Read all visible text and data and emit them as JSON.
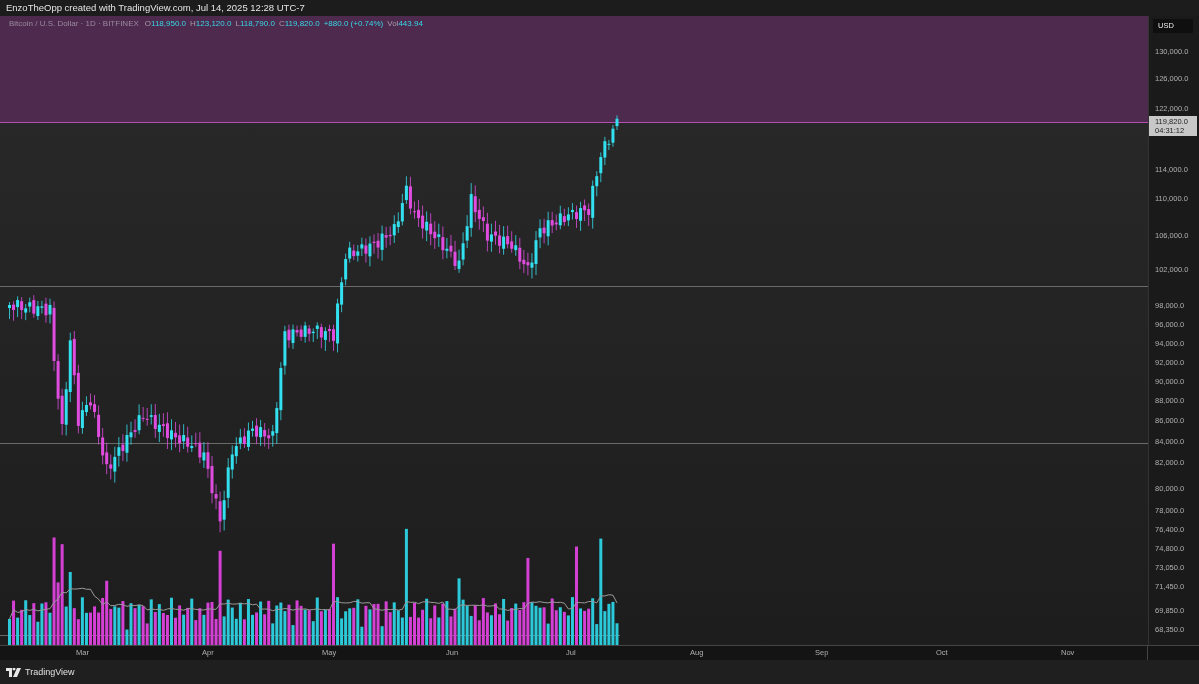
{
  "header": {
    "title": "EnzoTheOpp created with TradingView.com, Jul 14, 2025 12:28 UTC-7"
  },
  "legend": {
    "symbol": "Bitcoin / U.S. Dollar · 1D · BITFINEX",
    "ohlc": [
      {
        "label": "O",
        "value": "118,950.0"
      },
      {
        "label": "H",
        "value": "123,120.0"
      },
      {
        "label": "L",
        "value": "118,790.0"
      },
      {
        "label": "C",
        "value": "119,820.0"
      }
    ],
    "change": "+880.0 (+0.74%)",
    "volume": {
      "label": "Vol",
      "value": "443.94"
    }
  },
  "price_axis": {
    "currency": "USD",
    "labels": [
      "130,000.0",
      "126,000.0",
      "122,000.0",
      "114,000.0",
      "110,000.0",
      "106,000.0",
      "102,000.0",
      "98,000.0",
      "96,000.0",
      "94,000.0",
      "92,000.0",
      "90,000.0",
      "88,000.0",
      "86,000.0",
      "84,000.0",
      "82,000.0",
      "80,000.0",
      "78,000.0",
      "76,400.0",
      "74,800.0",
      "73,050.0",
      "71,450.0",
      "69,850.0",
      "68,350.0"
    ],
    "price_tag": {
      "price": "119,820.0",
      "countdown": "04:31:12"
    }
  },
  "time_axis": {
    "labels": [
      "Mar",
      "Apr",
      "May",
      "Jun",
      "Jul",
      "Aug",
      "Sep",
      "Oct",
      "Nov"
    ]
  },
  "footer": {
    "brand": "TradingView"
  }
}
